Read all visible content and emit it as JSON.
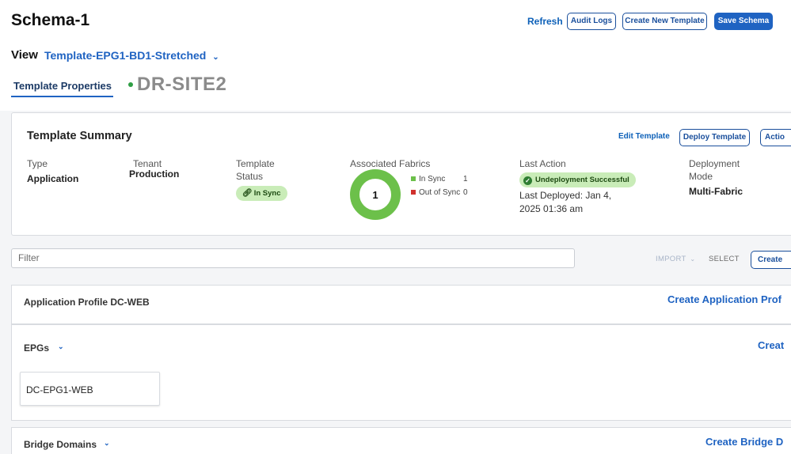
{
  "header": {
    "title": "Schema-1",
    "refresh_label": "Refresh",
    "audit_logs_label": "Audit Logs",
    "create_template_label": "Create New Template",
    "save_schema_label": "Save Schema"
  },
  "view": {
    "label": "View",
    "selected": "Template-EPG1-BD1-Stretched"
  },
  "tabs": {
    "properties": "Template Properties",
    "site": "DR-SITE2"
  },
  "summary": {
    "title": "Template Summary",
    "edit_label": "Edit Template",
    "deploy_label": "Deploy Template",
    "actions_label": "Actio",
    "type_label": "Type",
    "type_value": "Application",
    "tenant_label": "Tenant",
    "tenant_value": "Production",
    "status_label": "Template Status",
    "status_value": "In Sync",
    "fabrics_label": "Associated Fabrics",
    "fabrics_total": "1",
    "in_sync_label": "In Sync",
    "in_sync_count": "1",
    "out_of_sync_label": "Out of Sync",
    "out_of_sync_count": "0",
    "last_action_label": "Last Action",
    "last_action_value": "Undeployment Successful",
    "last_deployed": "Last Deployed: Jan 4, 2025 01:36 am",
    "mode_label": "Deployment Mode",
    "mode_value": "Multi-Fabric",
    "colors": {
      "in_sync": "#6cc04a",
      "out_of_sync": "#d0312d"
    }
  },
  "toolbar": {
    "filter_placeholder": "Filter",
    "import_label": "IMPORT",
    "select_label": "SELECT",
    "create_label": "Create"
  },
  "app_profile": {
    "title": "Application Profile DC-WEB",
    "create_label": "Create Application Prof"
  },
  "epgs": {
    "title": "EPGs",
    "create_label": "Creat",
    "items": [
      "DC-EPG1-WEB"
    ]
  },
  "bridge_domains": {
    "title": "Bridge Domains",
    "create_label": "Create Bridge D"
  }
}
